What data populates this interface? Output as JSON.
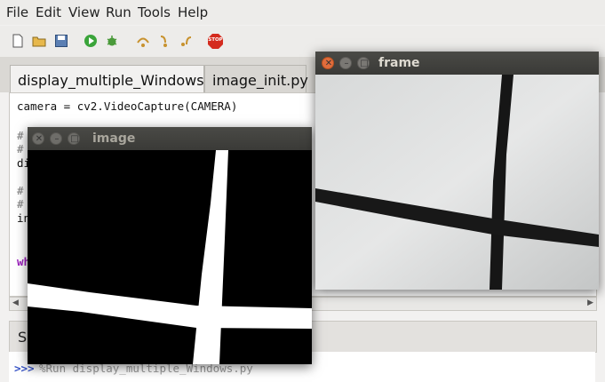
{
  "menubar": {
    "items": [
      "File",
      "Edit",
      "View",
      "Run",
      "Tools",
      "Help"
    ]
  },
  "toolbar": {
    "icons": [
      "new-file-icon",
      "open-folder-icon",
      "save-icon",
      "run-icon",
      "debug-icon",
      "step-over-icon",
      "step-into-icon",
      "step-out-icon",
      "stop-icon"
    ],
    "stop_label": "STOP"
  },
  "tabs": [
    {
      "label": "display_multiple_Windows.py"
    },
    {
      "label": "image_init.py"
    }
  ],
  "editor": {
    "lines": [
      "camera = cv2.VideoCapture(CAMERA)",
      "#",
      "#",
      "di",
      "#",
      "#",
      "in",
      "wh"
    ]
  },
  "shell": {
    "tab_label": "Sh",
    "prompt": ">>>",
    "command": "%Run display_multiple_Windows.py"
  },
  "windows": {
    "image": {
      "title": "image"
    },
    "frame": {
      "title": "frame"
    }
  },
  "colors": {
    "titlebar": "#3c3b37",
    "close_button": "#e06c3c",
    "keyword": "#9b1dbd"
  }
}
